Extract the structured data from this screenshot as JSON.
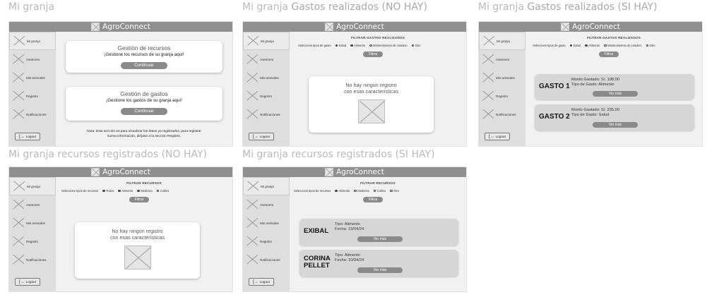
{
  "app": {
    "name": "AgroConnect",
    "logout": "Logout"
  },
  "nav": [
    "Mi granja",
    "Asesores",
    "Mis animales",
    "Registro",
    "Notificaciones"
  ],
  "frames": {
    "f1": {
      "title": "Mi granja",
      "cards": [
        {
          "title": "Gestión de recursos",
          "subtitle": "¡Gestione los recursos de su granja aquí!",
          "button": "Continuar"
        },
        {
          "title": "Gestión de gastos",
          "subtitle": "¡Gestione los gastos de su granja aquí!",
          "button": "Continuar"
        }
      ],
      "note_line1": "Nota: Esta sección es para visualizar los datos ya registrados, para registrar",
      "note_line2": "nueva información, diríjase a la sección Registro."
    },
    "f2": {
      "title_a": "Mi granja",
      "title_b": " Gastos realizados (NO HAY)",
      "filter_title": "FILTRAR GASTOS REALIZADOS",
      "filter_label": "Seleccione tipos de gasto",
      "options": [
        "Salud",
        "Alimento",
        "Mantenimiento de criadero",
        "Otro"
      ],
      "filter_button": "Filtrar",
      "empty_line1": "No hay ningún registro",
      "empty_line2": "con esas características"
    },
    "f3": {
      "title_a": "Mi granja",
      "title_b": " Gastos realizados (SI HAY)",
      "filter_title": "FILTRAR GASTOS REALIZADOS",
      "filter_label": "Seleccione tipos de gasto",
      "options": [
        "Salud",
        "Alimento",
        "Mantenimiento de criadero",
        "Otro"
      ],
      "filter_button": "Filtrar",
      "items": [
        {
          "name": "GASTO 1",
          "line1": "Monto Gastado: S/. 198.00",
          "line2": "Tipo de Gasto: Alimento",
          "button": "Ver más"
        },
        {
          "name": "GASTO 2",
          "line1": "Monto Gastado: S/. 235.00",
          "line2": "Tipo de Gasto: Salud",
          "button": "Ver más"
        }
      ]
    },
    "f4": {
      "title": "Mi granja recursos registrados (NO HAY)",
      "filter_title": "FILTRAR RECURSOS",
      "filter_label": "Seleccione tipos de recursos",
      "options": [
        "Todos",
        "Alimento",
        "Medicina",
        "Cultivo"
      ],
      "filter_button": "Filtrar",
      "empty_line1": "No hay ningún registro",
      "empty_line2": "con esas características"
    },
    "f5": {
      "title": "Mi granja recursos registrados (SI HAY)",
      "filter_title": "FILTRAR RECURSOS",
      "filter_label": "Seleccione tipos de recursos",
      "options": [
        "Alimento",
        "Medicina",
        "Cultivo",
        "Otro"
      ],
      "filter_button": "Filtrar",
      "items": [
        {
          "name_line1": "EXIBAL",
          "name_line2": "",
          "line1": "Tipo: Alimento",
          "line2": "Fecha: 13/04/24",
          "button": "Ver más"
        },
        {
          "name_line1": "CORINA",
          "name_line2": "PELLET",
          "line1": "Tipo: Alimento",
          "line2": "Fecha: 10/04/24",
          "button": "Ver más"
        }
      ]
    }
  }
}
